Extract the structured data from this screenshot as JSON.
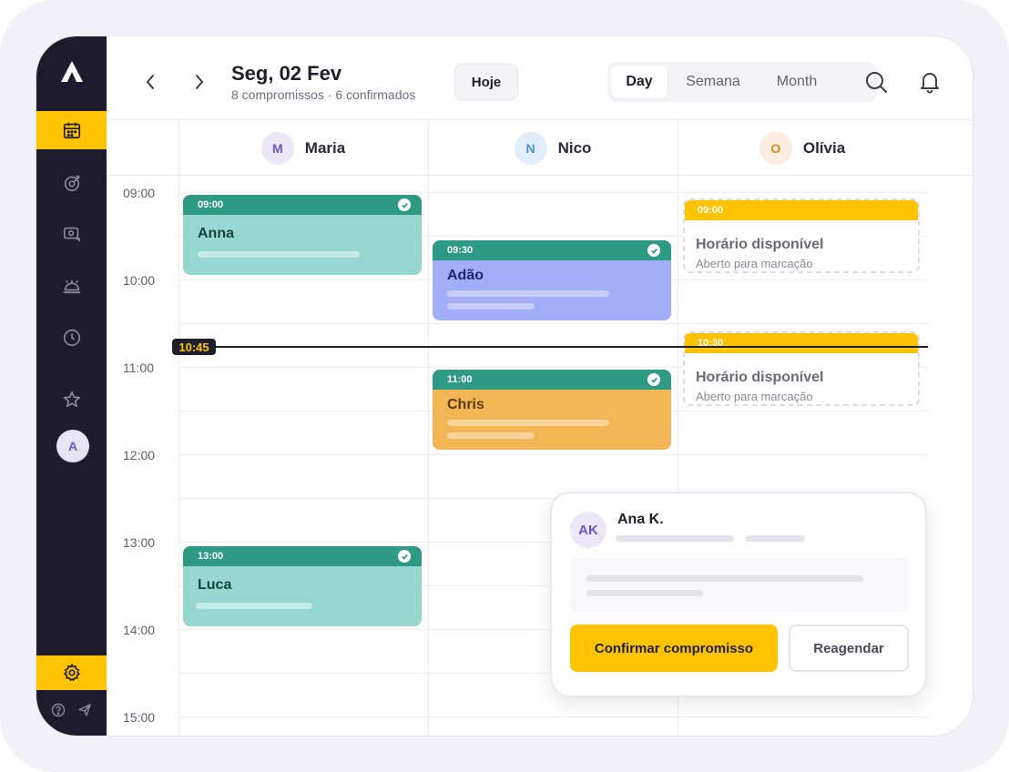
{
  "header": {
    "date_title": "Seg, 02 Fev",
    "date_subtitle": "8 compromissos · 6 confirmados",
    "today_label": "Hoje",
    "views": [
      "Day",
      "Semana",
      "Month"
    ],
    "active_view": "Day"
  },
  "sidebar": {
    "avatar_initial": "A",
    "active_color": "#ffc300",
    "icons": [
      "calendar-icon",
      "target-icon",
      "money-icon",
      "service-bell-icon",
      "clock-icon",
      "star-icon",
      "settings-icon",
      "help-icon",
      "send-icon"
    ]
  },
  "columns": [
    {
      "initial": "M",
      "name": "Maria",
      "avatar_bg": "#ebe7f8",
      "avatar_fg": "#6b57c9"
    },
    {
      "initial": "N",
      "name": "Nico",
      "avatar_bg": "#e3eefb",
      "avatar_fg": "#4a8ee0"
    },
    {
      "initial": "O",
      "name": "Olívia",
      "avatar_bg": "#fbeee0",
      "avatar_fg": "#e0851f"
    }
  ],
  "times": [
    "09:00",
    "10:00",
    "11:00",
    "12:00",
    "13:00",
    "14:00",
    "15:00"
  ],
  "now": "10:45",
  "events": [
    {
      "column": "Maria",
      "time": "09:00",
      "name": "Anna",
      "confirmed": true,
      "color": "#96d8cf"
    },
    {
      "column": "Nico",
      "time": "09:30",
      "name": "Adão",
      "confirmed": true,
      "color": "#a3aef9"
    },
    {
      "column": "Nico",
      "time": "11:00",
      "name": "Chris",
      "confirmed": true,
      "color": "#f2b654"
    },
    {
      "column": "Maria",
      "time": "13:00",
      "name": "Luca",
      "confirmed": true,
      "color": "#96d8cf"
    }
  ],
  "available_slots": [
    {
      "column": "Olívia",
      "time": "09:00",
      "title": "Horário disponível",
      "subtitle": "Aberto para marcação"
    },
    {
      "column": "Olívia",
      "time": "10:30",
      "title": "Horário disponível",
      "subtitle": "Aberto para marcação"
    }
  ],
  "popup": {
    "initials": "AK",
    "name": "Ana K.",
    "confirm_label": "Confirmar compromisso",
    "reschedule_label": "Reagendar"
  }
}
